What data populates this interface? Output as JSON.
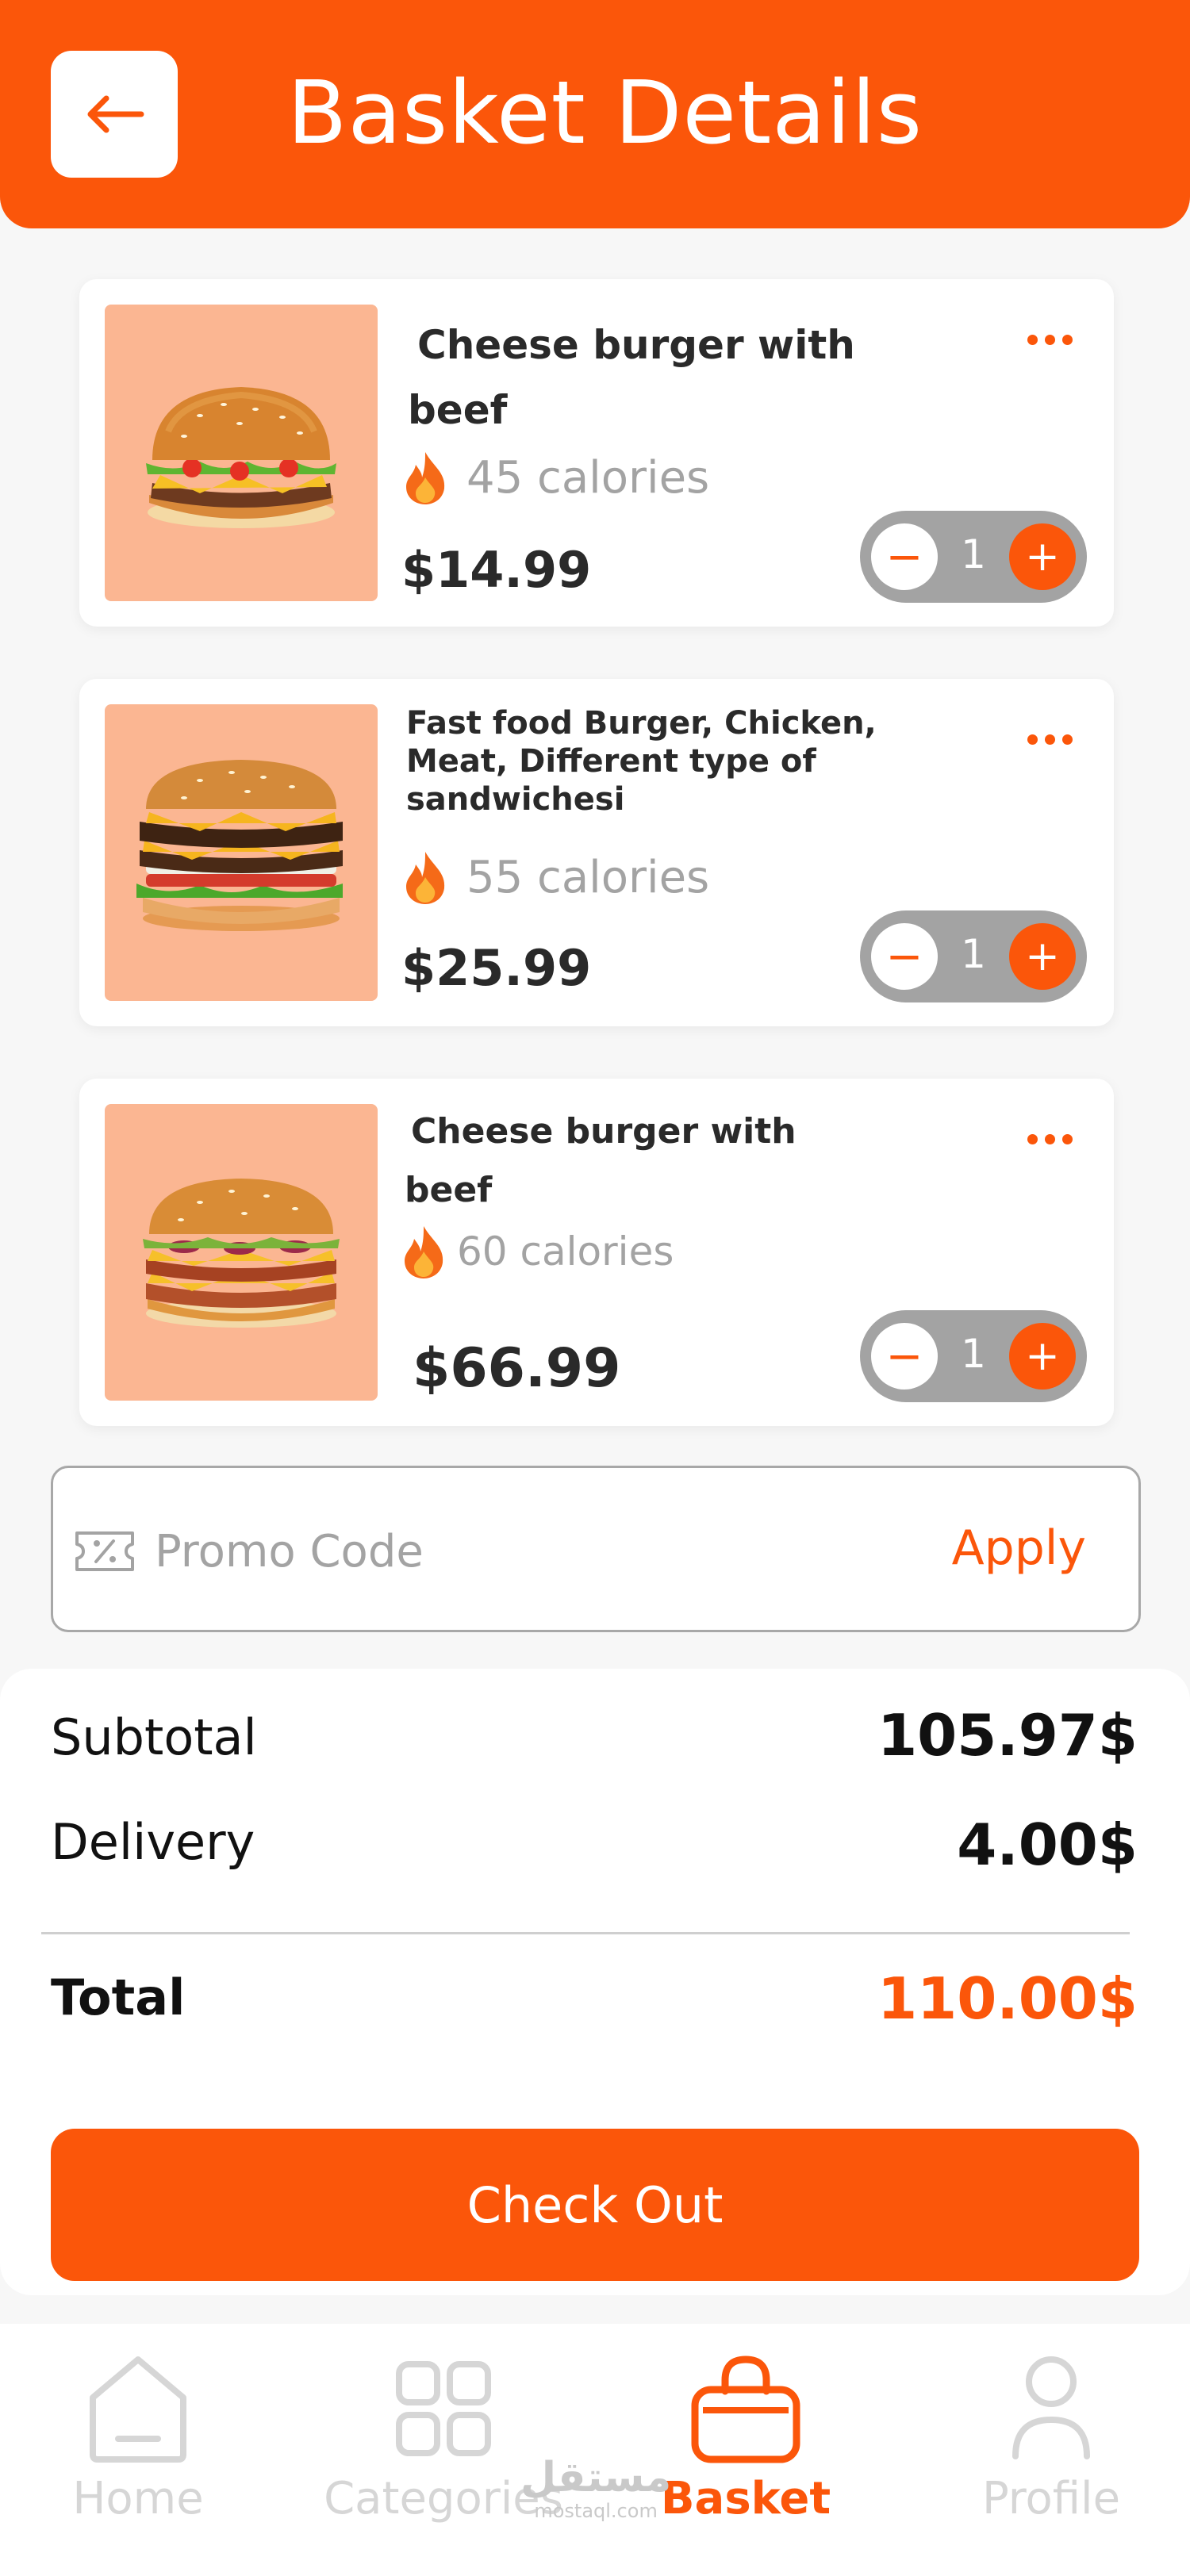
{
  "header": {
    "title": "Basket Details",
    "back_icon": "arrow-left-icon"
  },
  "colors": {
    "accent": "#fb560a",
    "image_bg": "#fbb692",
    "muted": "#a3a3a3",
    "nav_inactive": "#d6d6d6"
  },
  "items": [
    {
      "name_line1": "Cheese burger with",
      "name_line2": "beef",
      "calories": "45 calories",
      "price": "$14.99",
      "quantity": "1"
    },
    {
      "name_line1": "Fast food Burger, Chicken,",
      "name_line2": "Meat, Different type of",
      "name_line3": "sandwichesi",
      "calories": "55 calories",
      "price": "$25.99",
      "quantity": "1"
    },
    {
      "name_line1": "Cheese burger with",
      "name_line2": "beef",
      "calories": "60 calories",
      "price": "$66.99",
      "quantity": "1"
    }
  ],
  "stepper": {
    "minus": "−",
    "plus": "+"
  },
  "promo": {
    "placeholder": "Promo Code",
    "value": "",
    "apply_label": "Apply"
  },
  "summary": {
    "subtotal_label": "Subtotal",
    "subtotal_value": "105.97$",
    "delivery_label": "Delivery",
    "delivery_value": "4.00$",
    "total_label": "Total",
    "total_value": "110.00$"
  },
  "checkout_label": "Check Out",
  "nav": [
    {
      "label": "Home",
      "icon": "home-icon",
      "active": false
    },
    {
      "label": "Categories",
      "icon": "grid-icon",
      "active": false
    },
    {
      "label": "Basket",
      "icon": "shopping-bag-icon",
      "active": true
    },
    {
      "label": "Profile",
      "icon": "user-icon",
      "active": false
    }
  ],
  "watermark": {
    "arabic": "مستقل",
    "latin": "mostaql.com"
  }
}
